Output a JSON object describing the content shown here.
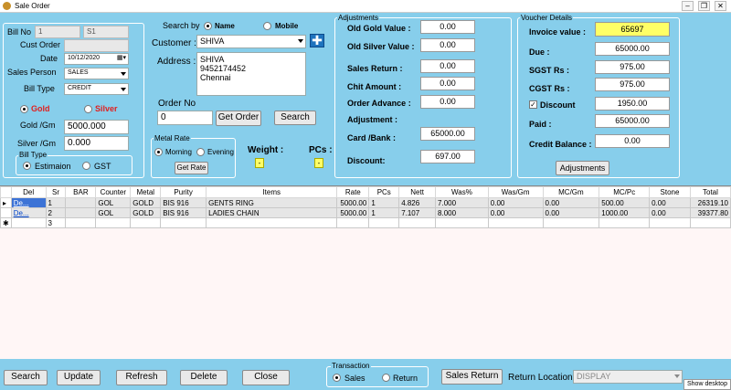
{
  "window": {
    "title": "Sale Order"
  },
  "left": {
    "bill_no_label": "Bill No",
    "bill_no_value": "1",
    "series_value": "S1",
    "cust_order_label": "Cust Order",
    "date_label": "Date",
    "date_value": "10/12/2020",
    "sales_person_label": "Sales Person",
    "sales_person_value": "SALES",
    "bill_type_label": "Bill Type",
    "bill_type_value": "CREDIT",
    "gold_label": "Gold",
    "silver_label": "Silver",
    "gold_rate_label": "Gold /Gm",
    "gold_rate_value": "5000.000",
    "silver_rate_label": "Silver /Gm",
    "silver_rate_value": "0.000",
    "bill_type_group": "Bill Type",
    "estimation_label": "Estimaion",
    "gst_label": "GST"
  },
  "middle": {
    "search_by_label": "Search by",
    "name_label": "Name",
    "mobile_label": "Mobile",
    "customer_label": "Customer :",
    "customer_value": "SHIVA",
    "address_label": "Address :",
    "address_lines": [
      "SHIVA",
      "9452174452",
      "Chennai"
    ],
    "order_no_label": "Order No",
    "order_no_value": "0",
    "get_order_label": "Get Order",
    "search_label": "Search",
    "metal_rate_group": "Metal Rate",
    "morning_label": "Morning",
    "evening_label": "Evening",
    "get_rate_label": "Get Rate",
    "weight_label": "Weight :",
    "weight_value": "-",
    "pcs_label": "PCs :",
    "pcs_value": "-"
  },
  "adjustments": {
    "group": "Adjustments",
    "old_gold_label": "Old Gold Value :",
    "old_gold_value": "0.00",
    "old_silver_label": "Old Silver Value :",
    "old_silver_value": "0.00",
    "sales_return_label": "Sales Return :",
    "sales_return_value": "0.00",
    "chit_label": "Chit Amount  :",
    "chit_value": "0.00",
    "order_adv_label": "Order Advance :",
    "order_adv_value": "0.00",
    "adjustment_label": "Adjustment :",
    "card_bank_label": "Card /Bank :",
    "card_bank_value": "65000.00",
    "discount_label": "Discount:",
    "discount_value": "697.00"
  },
  "voucher": {
    "group": "Voucher Details",
    "invoice_label": "Invoice value :",
    "invoice_value": "65697",
    "due_label": "Due :",
    "due_value": "65000.00",
    "sgst_label": "SGST Rs :",
    "sgst_value": "975.00",
    "cgst_label": "CGST Rs :",
    "cgst_value": "975.00",
    "discount_label": "Discount",
    "discount_value": "1950.00",
    "paid_label": "Paid :",
    "paid_value": "65000.00",
    "credit_label": "Credit Balance :",
    "credit_value": "0.00",
    "adjustments_button": "Adjustments"
  },
  "grid": {
    "columns": [
      "Del",
      "Sr",
      "BAR",
      "Counter",
      "Metal",
      "Purity",
      "Items",
      "Rate",
      "PCs",
      "Nett",
      "Was%",
      "Was/Gm",
      "MC/Gm",
      "MC/Pc",
      "Stone",
      "Total"
    ],
    "rows": [
      [
        "De...",
        "1",
        "",
        "GOL",
        "GOLD",
        "BIS 916",
        "GENTS RING",
        "5000.00",
        "1",
        "4.826",
        "7.000",
        "0.00",
        "0.00",
        "500.00",
        "0.00",
        "26319.10"
      ],
      [
        "De...",
        "2",
        "",
        "GOL",
        "GOLD",
        "BIS 916",
        "LADIES CHAIN",
        "5000.00",
        "1",
        "7.107",
        "8.000",
        "0.00",
        "0.00",
        "1000.00",
        "0.00",
        "39377.80"
      ],
      [
        "",
        "3",
        "",
        "",
        "",
        "",
        "",
        "",
        "",
        "",
        "",
        "",
        "",
        "",
        "",
        ""
      ]
    ]
  },
  "footer": {
    "search": "Search",
    "update": "Update",
    "refresh": "Refresh",
    "delete": "Delete",
    "close": "Close",
    "transaction_group": "Transaction",
    "sales": "Sales",
    "return": "Return",
    "sales_return": "Sales Return",
    "return_location_label": "Return Location :",
    "return_location_value": "DISPLAY",
    "show_desktop": "Show desktop"
  },
  "colors": {
    "background": "#87CEEB",
    "invoice_highlight": "#FFFF66",
    "gold_red": "#E02020"
  }
}
